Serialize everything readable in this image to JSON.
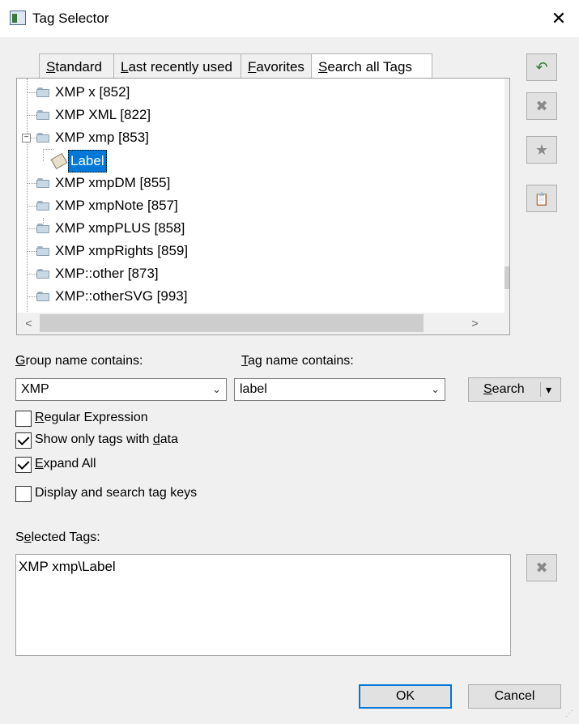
{
  "window": {
    "title": "Tag Selector",
    "close_glyph": "✕"
  },
  "tabs": [
    {
      "pre": "",
      "u": "S",
      "post": "tandard"
    },
    {
      "pre": "",
      "u": "L",
      "post": "ast recently used"
    },
    {
      "pre": "",
      "u": "F",
      "post": "avorites"
    },
    {
      "pre": "",
      "u": "S",
      "post": "earch all Tags"
    }
  ],
  "active_tab": 3,
  "tree": {
    "items": [
      {
        "label": "XMP x [852]"
      },
      {
        "label": "XMP XML [822]"
      },
      {
        "label": "XMP xmp [853]",
        "expanded": true,
        "expander": "−"
      },
      {
        "label": "Label",
        "selected": true,
        "child": true
      },
      {
        "label": "XMP xmpDM [855]"
      },
      {
        "label": "XMP xmpNote [857]"
      },
      {
        "label": "XMP xmpPLUS [858]"
      },
      {
        "label": "XMP xmpRights [859]"
      },
      {
        "label": "XMP::other [873]"
      },
      {
        "label": "XMP::otherSVG [993]"
      }
    ],
    "scroll_up": "⌃",
    "scroll_down": "⌄",
    "scroll_left": "<",
    "scroll_right": ">"
  },
  "side_buttons": [
    {
      "icon": "undo-arrow-icon",
      "glyph": "↶",
      "enabled": true,
      "color": "#2e7d32"
    },
    {
      "icon": "delete-x-icon",
      "glyph": "✖",
      "enabled": false
    },
    {
      "icon": "favorite-star-icon",
      "glyph": "★",
      "enabled": false
    },
    {
      "icon": "clipboard-icon",
      "glyph": "📋",
      "enabled": true
    }
  ],
  "filters": {
    "group_label": {
      "pre": "",
      "u": "G",
      "post": "roup name contains:"
    },
    "tag_label": {
      "pre": "",
      "u": "T",
      "post": "ag name contains:"
    },
    "group_value": "XMP",
    "tag_value": "label",
    "search_label": {
      "pre": "",
      "u": "S",
      "post": "earch"
    },
    "search_dropdown_glyph": "▾",
    "combo_arrow": "⌄"
  },
  "options": [
    {
      "pre": "",
      "u": "R",
      "post": "egular Expression",
      "checked": false
    },
    {
      "pre": "Show only tags with ",
      "u": "d",
      "post": "ata",
      "checked": true
    },
    {
      "pre": "",
      "u": "E",
      "post": "xpand All",
      "checked": true
    },
    {
      "pre": "Display and search tag keys",
      "u": "",
      "post": "",
      "checked": false
    }
  ],
  "selected_tags": {
    "label": {
      "pre": "S",
      "u": "e",
      "post": "lected Tags:"
    },
    "value": "XMP xmp\\Label",
    "remove_glyph": "✖"
  },
  "footer": {
    "ok": "OK",
    "cancel": "Cancel",
    "grip": "⋰"
  }
}
